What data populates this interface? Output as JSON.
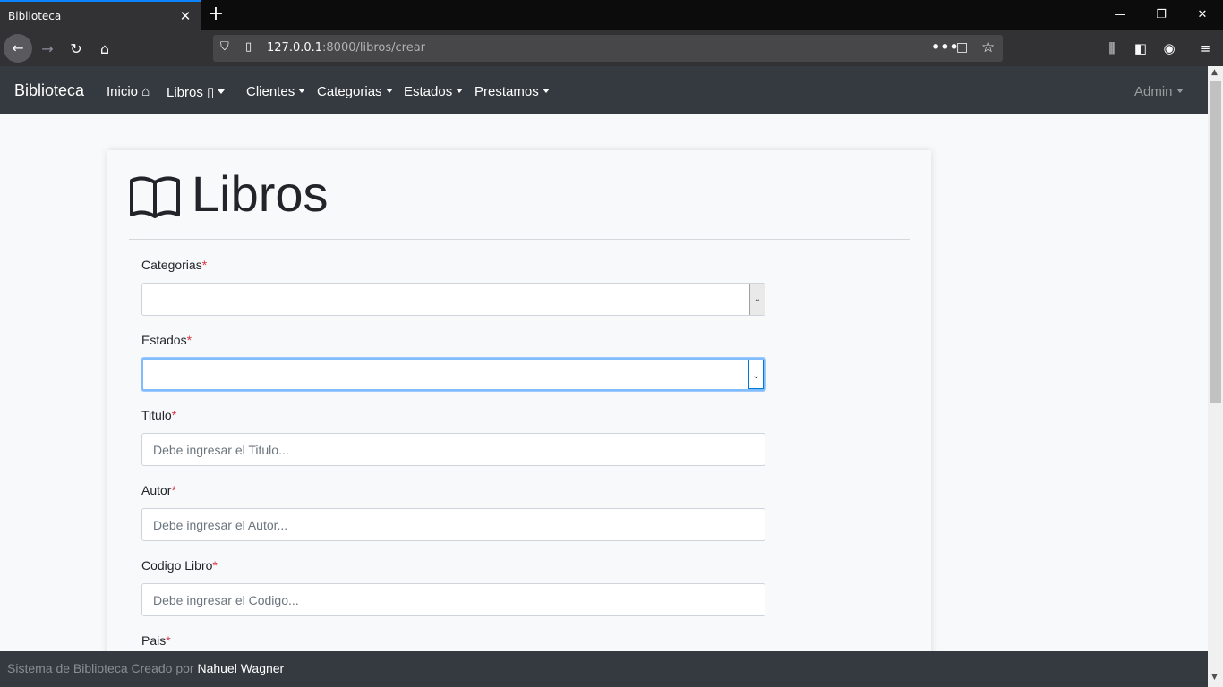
{
  "browser": {
    "tab_title": "Biblioteca",
    "url_host": "127.0.0.1",
    "url_rest": ":8000/libros/crear"
  },
  "site": {
    "brand": "Biblioteca",
    "nav": {
      "inicio": "Inicio",
      "libros": "Libros",
      "clientes": "Clientes",
      "categorias": "Categorias",
      "estados": "Estados",
      "prestamos": "Prestamos",
      "admin": "Admin"
    }
  },
  "page": {
    "title": "Libros"
  },
  "form": {
    "required_mark": "*",
    "categorias_label": "Categorias",
    "estados_label": "Estados",
    "titulo_label": "Titulo",
    "titulo_placeholder": "Debe ingresar el Titulo...",
    "autor_label": "Autor",
    "autor_placeholder": "Debe ingresar el Autor...",
    "codigo_label": "Codigo Libro",
    "codigo_placeholder": "Debe ingresar el Codigo...",
    "pais_label": "Pais"
  },
  "footer": {
    "text": "Sistema de Biblioteca Creado por ",
    "author": "Nahuel Wagner"
  }
}
